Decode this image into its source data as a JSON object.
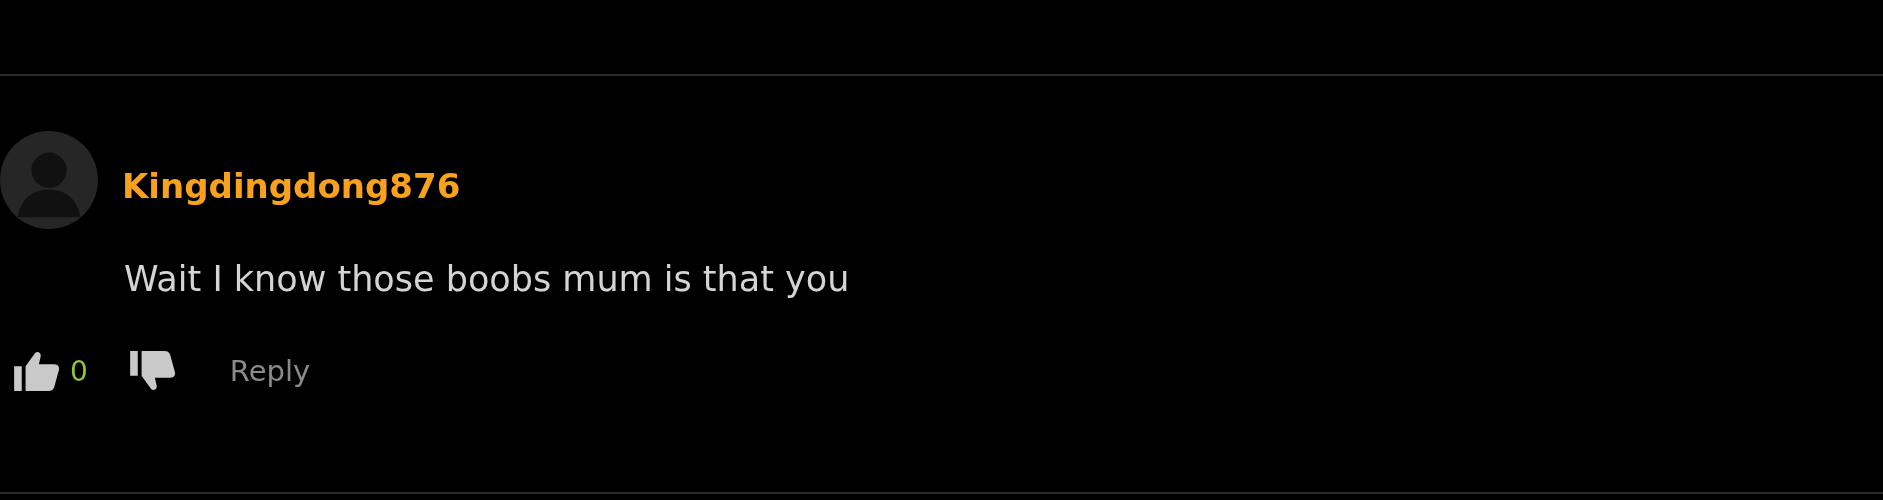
{
  "comment": {
    "author": "Kingdingdong876",
    "text": "Wait I know those boobs mum is that you",
    "likes": "0",
    "reply": "Reply"
  }
}
